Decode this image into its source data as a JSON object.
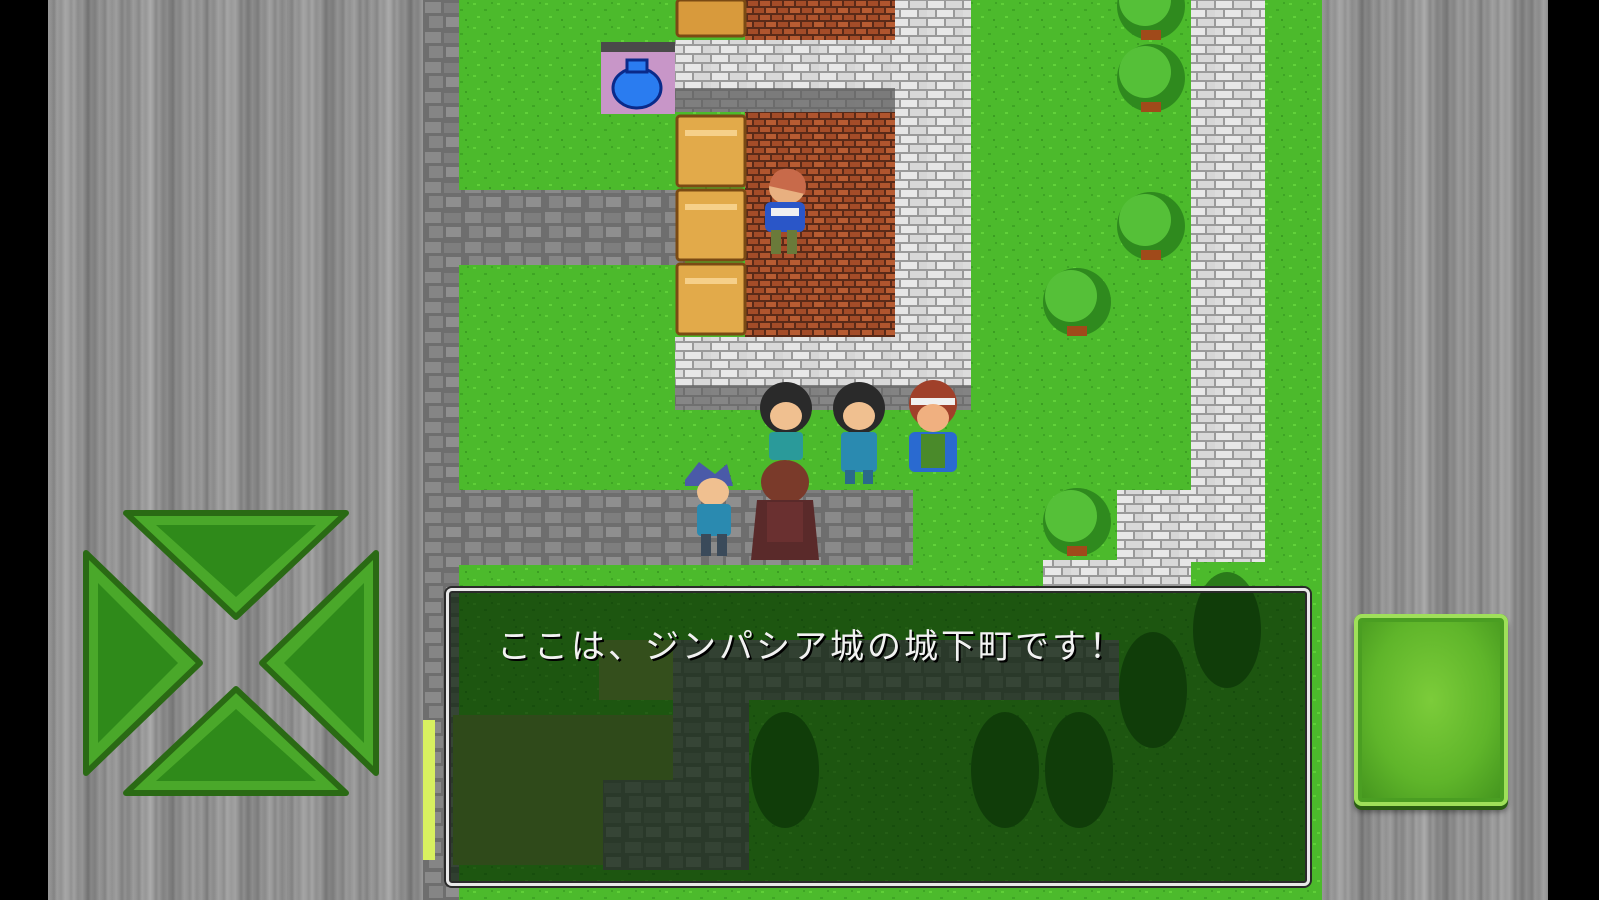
{
  "dialog": {
    "message": "ここは、ジンパシア城の城下町です！"
  },
  "controls": {
    "dpad_up_icon": "triangle-up-icon",
    "dpad_down_icon": "triangle-down-icon",
    "dpad_left_icon": "triangle-left-icon",
    "dpad_right_icon": "triangle-right-icon",
    "action_icon": "square-button-icon"
  },
  "colors": {
    "button_green": "#5fb52a",
    "grass": "#49b52a",
    "dialog_bg": "#0f2a0a",
    "metal": "#8f8f8f"
  }
}
